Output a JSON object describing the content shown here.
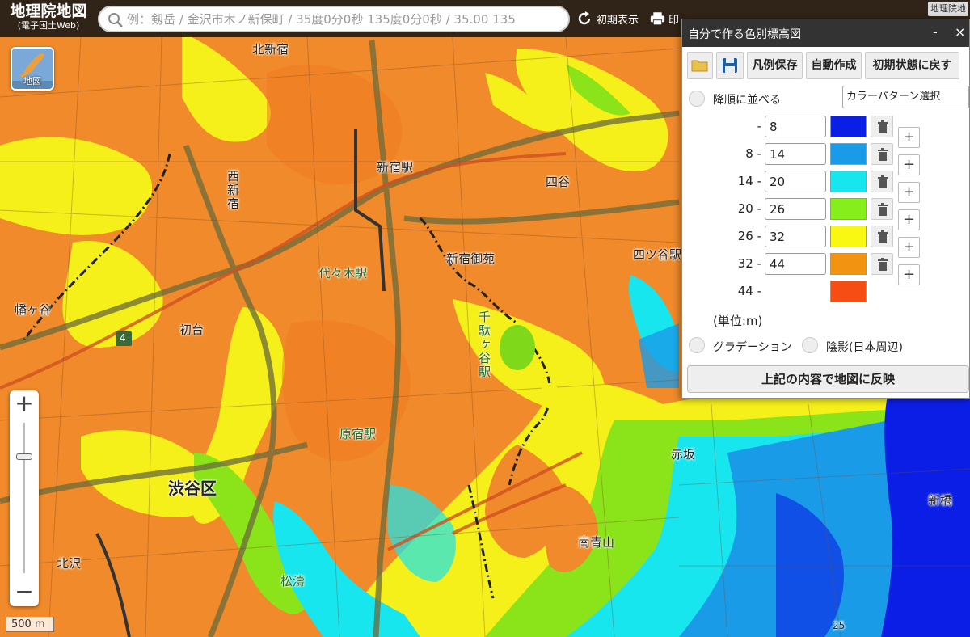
{
  "app": {
    "logo_title": "地理院地図",
    "logo_subtitle": "(電子国土Web)",
    "corner_badge": "地理院地"
  },
  "search": {
    "placeholder": "例：剱岳 / 金沢市木ノ新保町 / 35度0分0秒 135度0分0秒 / 35.00 135"
  },
  "header": {
    "reset_label": "初期表示",
    "print_label": "印"
  },
  "map": {
    "layer_button_label": "地図",
    "scale_label": "500 m",
    "zoom_in": "+",
    "zoom_out": "−",
    "place_labels": [
      {
        "id": "kita-shinjuku",
        "text": "北新宿"
      },
      {
        "id": "nishi-shinjuku",
        "text": "西新宿"
      },
      {
        "id": "shinjuku-station",
        "text": "新宿駅"
      },
      {
        "id": "yotsuya",
        "text": "四谷"
      },
      {
        "id": "shinjuku-gyoen",
        "text": "新宿御苑"
      },
      {
        "id": "yoyogi-station",
        "text": "代々木駅"
      },
      {
        "id": "yotsuya-r",
        "text": "四ツ谷駅"
      },
      {
        "id": "hatagaya",
        "text": "幡ヶ谷"
      },
      {
        "id": "hatsudai",
        "text": "初台"
      },
      {
        "id": "sendagaya",
        "text": "千駄ヶ谷駅"
      },
      {
        "id": "harajuku",
        "text": "原宿駅"
      },
      {
        "id": "akasaka",
        "text": "赤坂"
      },
      {
        "id": "shibuya-ku",
        "text": "渋谷区"
      },
      {
        "id": "minami-aoyama",
        "text": "南青山"
      },
      {
        "id": "kitazawa",
        "text": "北沢"
      },
      {
        "id": "shoto",
        "text": "松濤"
      },
      {
        "id": "shinbashi",
        "text": "新橋"
      },
      {
        "id": "route4",
        "text": "4"
      },
      {
        "id": "height-25",
        "text": "25"
      }
    ]
  },
  "dialog": {
    "title": "自分で作る色別標高図",
    "minimize": "-",
    "close": "×",
    "toolbar": {
      "legend_save": "凡例保存",
      "auto_create": "自動作成",
      "reset": "初期状態に戻す"
    },
    "sort_label": "降順に並べる",
    "pattern_select": "カラーパターン選択",
    "rows": [
      {
        "from": "-",
        "to": "8",
        "color": "#0b1ee6"
      },
      {
        "from": "8 -",
        "to": "14",
        "color": "#1a9be8"
      },
      {
        "from": "14 -",
        "to": "20",
        "color": "#18e6ee"
      },
      {
        "from": "20 -",
        "to": "26",
        "color": "#86ee1a"
      },
      {
        "from": "26 -",
        "to": "32",
        "color": "#f8f812"
      },
      {
        "from": "32 -",
        "to": "44",
        "color": "#f39312"
      },
      {
        "from": "44 -",
        "to": "",
        "color": "#f64d14"
      }
    ],
    "add_label": "+",
    "unit_label": "(単位:m)",
    "gradation_label": "グラデーション",
    "shade_label": "陰影(日本周辺)",
    "apply_label": "上記の内容で地図に反映"
  }
}
